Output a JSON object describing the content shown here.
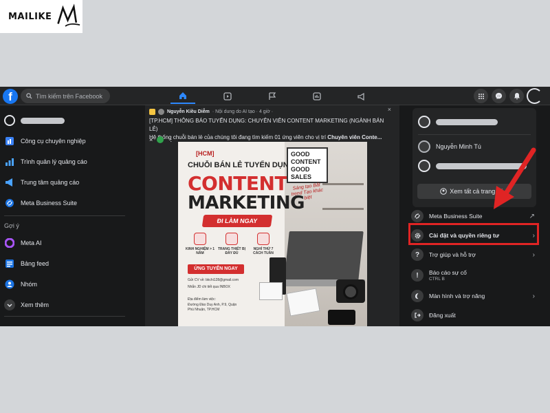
{
  "brand": {
    "logo_text": "MAILIKE"
  },
  "search": {
    "placeholder": "Tìm kiếm trên Facebook"
  },
  "left_menu": {
    "items": [
      {
        "label": "Công cụ chuyên nghiệp",
        "icon": "pro-tools-icon"
      },
      {
        "label": "Trình quản lý quảng cáo",
        "icon": "ads-manager-icon"
      },
      {
        "label": "Trung tâm quảng cáo",
        "icon": "megaphone-icon"
      },
      {
        "label": "Meta Business Suite",
        "icon": "business-suite-icon"
      }
    ],
    "section_title": "Gợi ý",
    "suggestions": [
      {
        "label": "Meta AI",
        "icon": "meta-ai-icon"
      },
      {
        "label": "Bảng feed",
        "icon": "feed-icon"
      },
      {
        "label": "Nhóm",
        "icon": "groups-icon"
      },
      {
        "label": "Xem thêm",
        "icon": "chevron-down-icon"
      }
    ]
  },
  "post": {
    "author": "Nguyễn Kiều Diễm",
    "meta": "· Nội dung do AI tạo · 4 giờ ·",
    "text_line1": "[TP.HCM] THÔNG BÁO TUYỂN DỤNG: CHUYÊN VIÊN CONTENT MARKETING (NGÀNH BÁN LẺ)",
    "text_line2_prefix": "Hệ thống chuỗi bán lẻ của chúng tôi đang tìm kiếm 01 ứng viên cho vị trí ",
    "text_line2_bold": "Chuyên viên Conte...",
    "close_symbol": "×"
  },
  "poster": {
    "tag": "[HCM]",
    "headline": "CHUỖI BÁN LẺ TUYỂN DỤNG",
    "big1": "CONTENT",
    "big2": "MARKETING",
    "ribbon": "ĐI LÀM NGAY",
    "box_text": [
      "GOOD",
      "CONTENT",
      "GOOD",
      "SALES"
    ],
    "script": "Sáng tạo Bắt trend Tạo khác biệt",
    "features": [
      "KINH NGHIỆM > 1 NĂM",
      "TRANG THIẾT BỊ ĐẦY ĐỦ",
      "NGHỈ THỨ 7 CÁCH TUẦN"
    ],
    "apply": "ỨNG TUYỂN NGAY",
    "contact1": "Gửi CV về: bkchi128@gmail.com",
    "contact2": "Nhắn JD chi tiết qua INBOX",
    "address_label": "Địa điểm làm việc:",
    "address": "Đường Đào Duy Anh, P.9, Quận Phú Nhuận, TP.HCM"
  },
  "account_menu": {
    "profile_name": "Nguyễn Minh Tú",
    "see_all": "Xem tất cả trang cá n",
    "items": [
      {
        "label": "Meta Business Suite",
        "sub": "",
        "icon": "business-suite-icon"
      },
      {
        "label": "Cài đặt và quyền riêng tư",
        "sub": "",
        "icon": "gear-icon"
      },
      {
        "label": "Trợ giúp và hỗ trợ",
        "sub": "",
        "icon": "help-icon"
      },
      {
        "label": "Báo cáo sự cố",
        "sub": "CTRL B",
        "icon": "report-icon"
      },
      {
        "label": "Màn hình và trợ năng",
        "sub": "",
        "icon": "moon-icon"
      },
      {
        "label": "Đăng xuất",
        "sub": "",
        "icon": "logout-icon"
      }
    ]
  },
  "colors": {
    "fb_blue": "#1877f2",
    "highlight_red": "#e02424",
    "dark_bg": "#18191a",
    "card_bg": "#242526"
  }
}
